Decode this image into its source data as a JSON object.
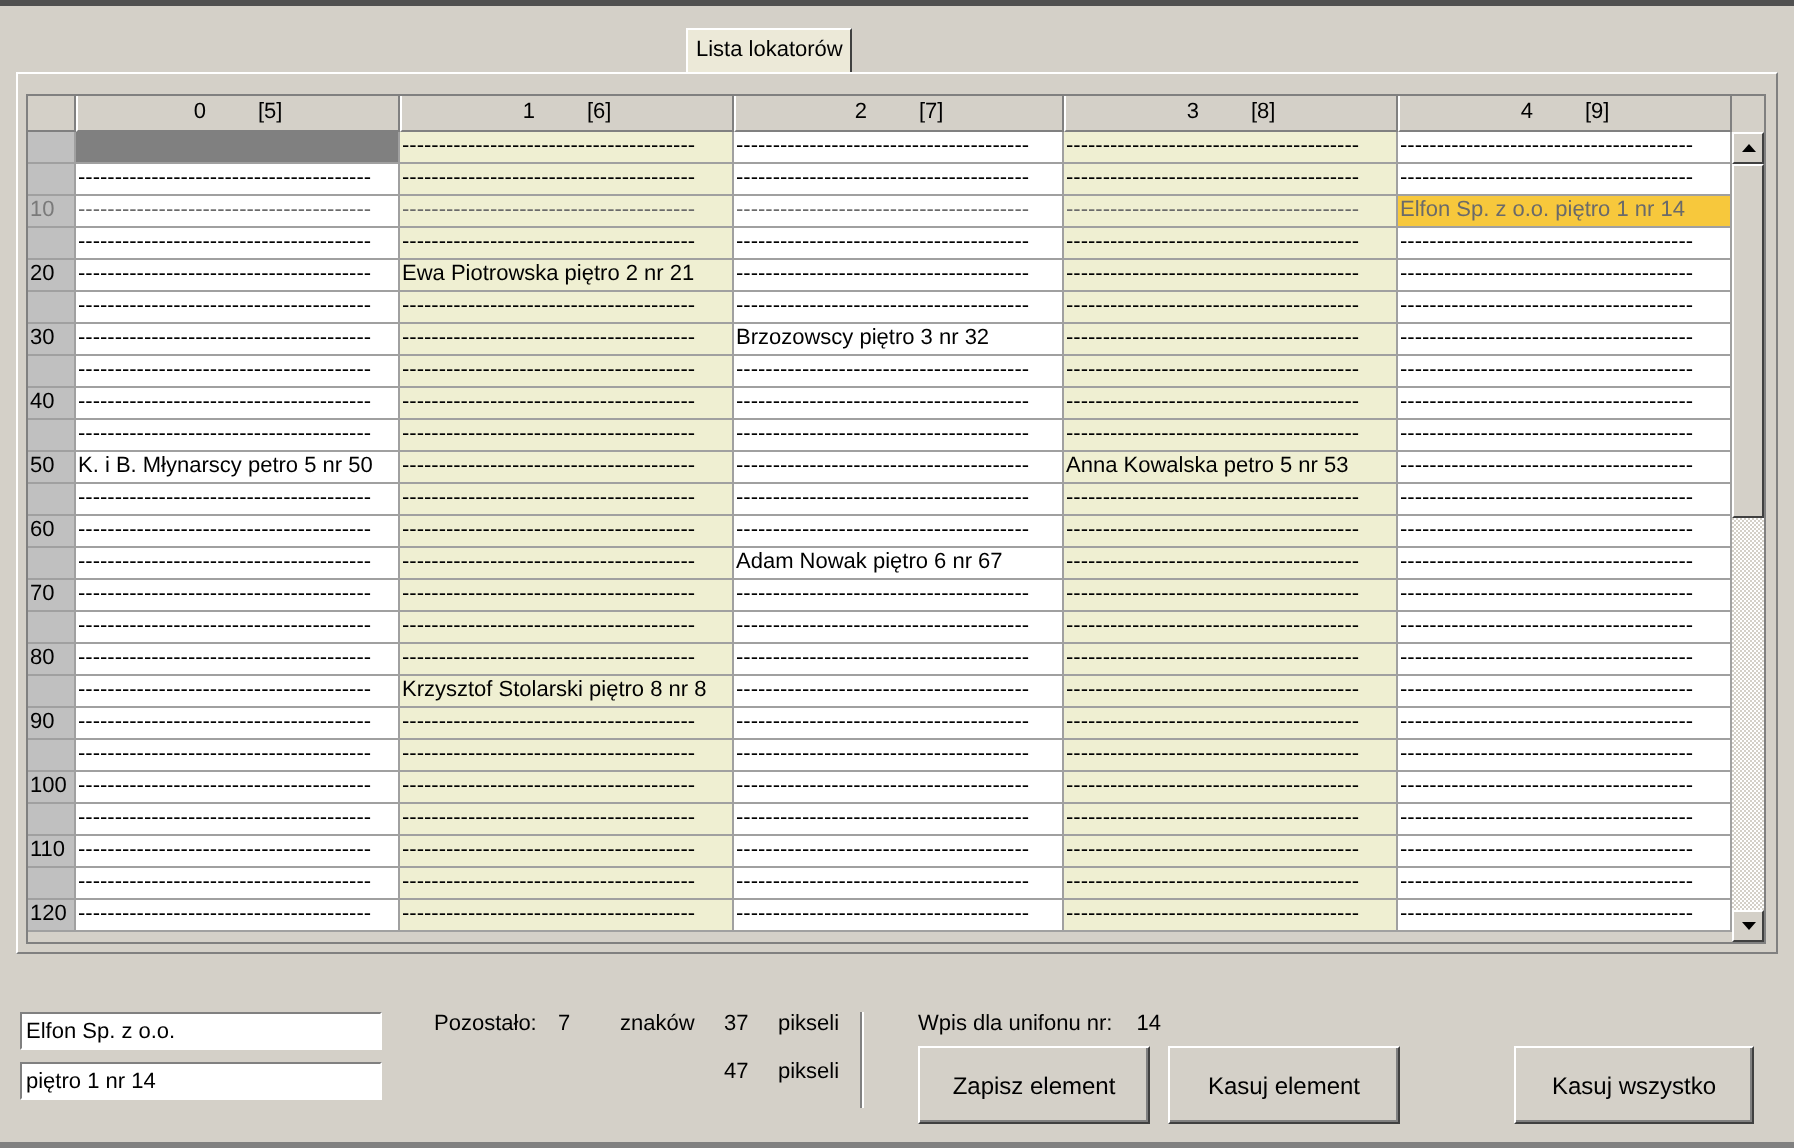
{
  "tabs": [
    {
      "label": "Lista lokatorów",
      "selected": true
    }
  ],
  "grid": {
    "columns": [
      {
        "number": "0",
        "count": "[5]",
        "shaded": false
      },
      {
        "number": "1",
        "count": "[6]",
        "shaded": true
      },
      {
        "number": "2",
        "count": "[7]",
        "shaded": false
      },
      {
        "number": "3",
        "count": "[8]",
        "shaded": true
      },
      {
        "number": "4",
        "count": "[9]",
        "shaded": false
      }
    ],
    "rows": [
      {
        "label": "",
        "active": false,
        "cells": [
          {
            "selected": false,
            "focused": true
          },
          {
            "text": "----------------------------------------",
            "selected": false,
            "focused": false
          },
          {
            "text": "----------------------------------------",
            "selected": false,
            "focused": false
          },
          {
            "text": "----------------------------------------",
            "selected": false,
            "focused": false
          },
          {
            "text": "----------------------------------------",
            "selected": false,
            "focused": false
          }
        ]
      },
      {
        "label": "",
        "active": false,
        "cells": [
          {
            "text": "----------------------------------------",
            "selected": false,
            "focused": false
          },
          {
            "text": "----------------------------------------",
            "selected": false,
            "focused": false
          },
          {
            "text": "----------------------------------------",
            "selected": false,
            "focused": false
          },
          {
            "text": "----------------------------------------",
            "selected": false,
            "focused": false
          },
          {
            "text": "----------------------------------------",
            "selected": false,
            "focused": false
          }
        ]
      },
      {
        "label": "10",
        "active": true,
        "cells": [
          {
            "text": "----------------------------------------",
            "selected": false,
            "focused": false
          },
          {
            "text": "----------------------------------------",
            "selected": false,
            "focused": false
          },
          {
            "text": "----------------------------------------",
            "selected": false,
            "focused": false
          },
          {
            "text": "----------------------------------------",
            "selected": false,
            "focused": false
          },
          {
            "text": "Elfon Sp. z o.o. piętro 1 nr 14",
            "selected": true,
            "focused": false
          }
        ]
      },
      {
        "label": "",
        "active": false,
        "cells": [
          {
            "text": "----------------------------------------",
            "selected": false,
            "focused": false
          },
          {
            "text": "----------------------------------------",
            "selected": false,
            "focused": false
          },
          {
            "text": "----------------------------------------",
            "selected": false,
            "focused": false
          },
          {
            "text": "----------------------------------------",
            "selected": false,
            "focused": false
          },
          {
            "text": "----------------------------------------",
            "selected": false,
            "focused": false
          }
        ]
      },
      {
        "label": "20",
        "active": false,
        "cells": [
          {
            "text": "----------------------------------------",
            "selected": false,
            "focused": false
          },
          {
            "text": "Ewa Piotrowska piętro 2 nr 21",
            "selected": false,
            "focused": false
          },
          {
            "text": "----------------------------------------",
            "selected": false,
            "focused": false
          },
          {
            "text": "----------------------------------------",
            "selected": false,
            "focused": false
          },
          {
            "text": "----------------------------------------",
            "selected": false,
            "focused": false
          }
        ]
      },
      {
        "label": "",
        "active": false,
        "cells": [
          {
            "text": "----------------------------------------",
            "selected": false,
            "focused": false
          },
          {
            "text": "----------------------------------------",
            "selected": false,
            "focused": false
          },
          {
            "text": "----------------------------------------",
            "selected": false,
            "focused": false
          },
          {
            "text": "----------------------------------------",
            "selected": false,
            "focused": false
          },
          {
            "text": "----------------------------------------",
            "selected": false,
            "focused": false
          }
        ]
      },
      {
        "label": "30",
        "active": false,
        "cells": [
          {
            "text": "----------------------------------------",
            "selected": false,
            "focused": false
          },
          {
            "text": "----------------------------------------",
            "selected": false,
            "focused": false
          },
          {
            "text": "Brzozowscy piętro 3 nr 32",
            "selected": false,
            "focused": false
          },
          {
            "text": "----------------------------------------",
            "selected": false,
            "focused": false
          },
          {
            "text": "----------------------------------------",
            "selected": false,
            "focused": false
          }
        ]
      },
      {
        "label": "",
        "active": false,
        "cells": [
          {
            "text": "----------------------------------------",
            "selected": false,
            "focused": false
          },
          {
            "text": "----------------------------------------",
            "selected": false,
            "focused": false
          },
          {
            "text": "----------------------------------------",
            "selected": false,
            "focused": false
          },
          {
            "text": "----------------------------------------",
            "selected": false,
            "focused": false
          },
          {
            "text": "----------------------------------------",
            "selected": false,
            "focused": false
          }
        ]
      },
      {
        "label": "40",
        "active": false,
        "cells": [
          {
            "text": "----------------------------------------",
            "selected": false,
            "focused": false
          },
          {
            "text": "----------------------------------------",
            "selected": false,
            "focused": false
          },
          {
            "text": "----------------------------------------",
            "selected": false,
            "focused": false
          },
          {
            "text": "----------------------------------------",
            "selected": false,
            "focused": false
          },
          {
            "text": "----------------------------------------",
            "selected": false,
            "focused": false
          }
        ]
      },
      {
        "label": "",
        "active": false,
        "cells": [
          {
            "text": "----------------------------------------",
            "selected": false,
            "focused": false
          },
          {
            "text": "----------------------------------------",
            "selected": false,
            "focused": false
          },
          {
            "text": "----------------------------------------",
            "selected": false,
            "focused": false
          },
          {
            "text": "----------------------------------------",
            "selected": false,
            "focused": false
          },
          {
            "text": "----------------------------------------",
            "selected": false,
            "focused": false
          }
        ]
      },
      {
        "label": "50",
        "active": false,
        "cells": [
          {
            "text": "K. i B. Młynarscy petro 5 nr 50",
            "selected": false,
            "focused": false
          },
          {
            "text": "----------------------------------------",
            "selected": false,
            "focused": false
          },
          {
            "text": "----------------------------------------",
            "selected": false,
            "focused": false
          },
          {
            "text": "Anna Kowalska petro 5 nr 53",
            "selected": false,
            "focused": false
          },
          {
            "text": "----------------------------------------",
            "selected": false,
            "focused": false
          }
        ]
      },
      {
        "label": "",
        "active": false,
        "cells": [
          {
            "text": "----------------------------------------",
            "selected": false,
            "focused": false
          },
          {
            "text": "----------------------------------------",
            "selected": false,
            "focused": false
          },
          {
            "text": "----------------------------------------",
            "selected": false,
            "focused": false
          },
          {
            "text": "----------------------------------------",
            "selected": false,
            "focused": false
          },
          {
            "text": "----------------------------------------",
            "selected": false,
            "focused": false
          }
        ]
      },
      {
        "label": "60",
        "active": false,
        "cells": [
          {
            "text": "----------------------------------------",
            "selected": false,
            "focused": false
          },
          {
            "text": "----------------------------------------",
            "selected": false,
            "focused": false
          },
          {
            "text": "----------------------------------------",
            "selected": false,
            "focused": false
          },
          {
            "text": "----------------------------------------",
            "selected": false,
            "focused": false
          },
          {
            "text": "----------------------------------------",
            "selected": false,
            "focused": false
          }
        ]
      },
      {
        "label": "",
        "active": false,
        "cells": [
          {
            "text": "----------------------------------------",
            "selected": false,
            "focused": false
          },
          {
            "text": "----------------------------------------",
            "selected": false,
            "focused": false
          },
          {
            "text": "Adam Nowak piętro 6 nr 67",
            "selected": false,
            "focused": false
          },
          {
            "text": "----------------------------------------",
            "selected": false,
            "focused": false
          },
          {
            "text": "----------------------------------------",
            "selected": false,
            "focused": false
          }
        ]
      },
      {
        "label": "70",
        "active": false,
        "cells": [
          {
            "text": "----------------------------------------",
            "selected": false,
            "focused": false
          },
          {
            "text": "----------------------------------------",
            "selected": false,
            "focused": false
          },
          {
            "text": "----------------------------------------",
            "selected": false,
            "focused": false
          },
          {
            "text": "----------------------------------------",
            "selected": false,
            "focused": false
          },
          {
            "text": "----------------------------------------",
            "selected": false,
            "focused": false
          }
        ]
      },
      {
        "label": "",
        "active": false,
        "cells": [
          {
            "text": "----------------------------------------",
            "selected": false,
            "focused": false
          },
          {
            "text": "----------------------------------------",
            "selected": false,
            "focused": false
          },
          {
            "text": "----------------------------------------",
            "selected": false,
            "focused": false
          },
          {
            "text": "----------------------------------------",
            "selected": false,
            "focused": false
          },
          {
            "text": "----------------------------------------",
            "selected": false,
            "focused": false
          }
        ]
      },
      {
        "label": "80",
        "active": false,
        "cells": [
          {
            "text": "----------------------------------------",
            "selected": false,
            "focused": false
          },
          {
            "text": "----------------------------------------",
            "selected": false,
            "focused": false
          },
          {
            "text": "----------------------------------------",
            "selected": false,
            "focused": false
          },
          {
            "text": "----------------------------------------",
            "selected": false,
            "focused": false
          },
          {
            "text": "----------------------------------------",
            "selected": false,
            "focused": false
          }
        ]
      },
      {
        "label": "",
        "active": false,
        "cells": [
          {
            "text": "----------------------------------------",
            "selected": false,
            "focused": false
          },
          {
            "text": "Krzysztof Stolarski piętro 8 nr 8",
            "selected": false,
            "focused": false
          },
          {
            "text": "----------------------------------------",
            "selected": false,
            "focused": false
          },
          {
            "text": "----------------------------------------",
            "selected": false,
            "focused": false
          },
          {
            "text": "----------------------------------------",
            "selected": false,
            "focused": false
          }
        ]
      },
      {
        "label": "90",
        "active": false,
        "cells": [
          {
            "text": "----------------------------------------",
            "selected": false,
            "focused": false
          },
          {
            "text": "----------------------------------------",
            "selected": false,
            "focused": false
          },
          {
            "text": "----------------------------------------",
            "selected": false,
            "focused": false
          },
          {
            "text": "----------------------------------------",
            "selected": false,
            "focused": false
          },
          {
            "text": "----------------------------------------",
            "selected": false,
            "focused": false
          }
        ]
      },
      {
        "label": "",
        "active": false,
        "cells": [
          {
            "text": "----------------------------------------",
            "selected": false,
            "focused": false
          },
          {
            "text": "----------------------------------------",
            "selected": false,
            "focused": false
          },
          {
            "text": "----------------------------------------",
            "selected": false,
            "focused": false
          },
          {
            "text": "----------------------------------------",
            "selected": false,
            "focused": false
          },
          {
            "text": "----------------------------------------",
            "selected": false,
            "focused": false
          }
        ]
      },
      {
        "label": "100",
        "active": false,
        "cells": [
          {
            "text": "----------------------------------------",
            "selected": false,
            "focused": false
          },
          {
            "text": "----------------------------------------",
            "selected": false,
            "focused": false
          },
          {
            "text": "----------------------------------------",
            "selected": false,
            "focused": false
          },
          {
            "text": "----------------------------------------",
            "selected": false,
            "focused": false
          },
          {
            "text": "----------------------------------------",
            "selected": false,
            "focused": false
          }
        ]
      },
      {
        "label": "",
        "active": false,
        "cells": [
          {
            "text": "----------------------------------------",
            "selected": false,
            "focused": false
          },
          {
            "text": "----------------------------------------",
            "selected": false,
            "focused": false
          },
          {
            "text": "----------------------------------------",
            "selected": false,
            "focused": false
          },
          {
            "text": "----------------------------------------",
            "selected": false,
            "focused": false
          },
          {
            "text": "----------------------------------------",
            "selected": false,
            "focused": false
          }
        ]
      },
      {
        "label": "110",
        "active": false,
        "cells": [
          {
            "text": "----------------------------------------",
            "selected": false,
            "focused": false
          },
          {
            "text": "----------------------------------------",
            "selected": false,
            "focused": false
          },
          {
            "text": "----------------------------------------",
            "selected": false,
            "focused": false
          },
          {
            "text": "----------------------------------------",
            "selected": false,
            "focused": false
          },
          {
            "text": "----------------------------------------",
            "selected": false,
            "focused": false
          }
        ]
      },
      {
        "label": "",
        "active": false,
        "cells": [
          {
            "text": "----------------------------------------",
            "selected": false,
            "focused": false
          },
          {
            "text": "----------------------------------------",
            "selected": false,
            "focused": false
          },
          {
            "text": "----------------------------------------",
            "selected": false,
            "focused": false
          },
          {
            "text": "----------------------------------------",
            "selected": false,
            "focused": false
          },
          {
            "text": "----------------------------------------",
            "selected": false,
            "focused": false
          }
        ]
      },
      {
        "label": "120",
        "active": false,
        "cells": [
          {
            "text": "----------------------------------------",
            "selected": false,
            "focused": false
          },
          {
            "text": "----------------------------------------",
            "selected": false,
            "focused": false
          },
          {
            "text": "----------------------------------------",
            "selected": false,
            "focused": false
          },
          {
            "text": "----------------------------------------",
            "selected": false,
            "focused": false
          },
          {
            "text": "----------------------------------------",
            "selected": false,
            "focused": false
          }
        ]
      }
    ]
  },
  "editor": {
    "name_value": "Elfon Sp. z o.o. ",
    "address_value": "piętro 1 nr 14",
    "remaining_label": "Pozostało:",
    "remaining_chars": "7",
    "chars_label": "znaków",
    "pixels_1": "37",
    "pixels_label_1": "pikseli",
    "pixels_2": "47",
    "pixels_label_2": "pikseli",
    "entry_label": "Wpis dla unifonu nr:",
    "entry_number": "14"
  },
  "buttons": [
    "Zapisz element",
    "Kasuj element",
    "Kasuj wszystko"
  ]
}
